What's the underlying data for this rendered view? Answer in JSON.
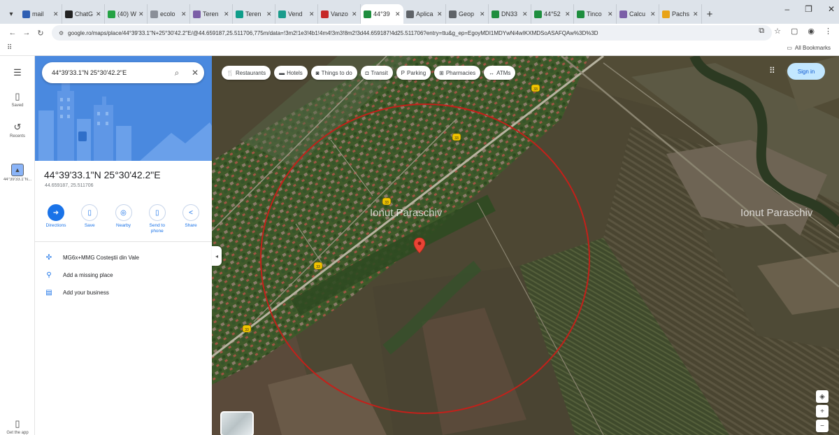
{
  "browser": {
    "tabs": [
      {
        "title": "mail",
        "favicon_color": "#2f5fb3"
      },
      {
        "title": "ChatG",
        "favicon_color": "#222222"
      },
      {
        "title": "(40) W",
        "favicon_color": "#25a244"
      },
      {
        "title": "ecolo",
        "favicon_color": "#8a8f98"
      },
      {
        "title": "Teren",
        "favicon_color": "#7b5ea7"
      },
      {
        "title": "Teren",
        "favicon_color": "#0f9d8a"
      },
      {
        "title": "Vend",
        "favicon_color": "#1a9c8c"
      },
      {
        "title": "Vanzo",
        "favicon_color": "#c62828"
      },
      {
        "title": "44°39",
        "favicon_color": "#1e8e3e",
        "active": true
      },
      {
        "title": "Aplica",
        "favicon_color": "#5f6368"
      },
      {
        "title": "Geop",
        "favicon_color": "#5f6368"
      },
      {
        "title": "DN33",
        "favicon_color": "#1e8e3e"
      },
      {
        "title": "44°52",
        "favicon_color": "#1e8e3e"
      },
      {
        "title": "Tinco",
        "favicon_color": "#1e8e3e"
      },
      {
        "title": "Calcu",
        "favicon_color": "#7b5ea7"
      },
      {
        "title": "Pachs",
        "favicon_color": "#e8a317"
      }
    ],
    "new_tab": "+",
    "url": "google.ro/maps/place/44°39'33.1\"N+25°30'42.2\"E/@44.659187,25.511706,775m/data=!3m2!1e3!4b1!4m4!3m3!8m2!3d44.659187!4d25.511706?entry=ttu&g_ep=EgoyMDI1MDYwNi4wIKXMDSoASAFQAw%3D%3D",
    "all_bookmarks": "All Bookmarks"
  },
  "rail": {
    "saved": "Saved",
    "recents": "Recents",
    "recent_place": "44°39'33.1\"N...",
    "get_app": "Get the app"
  },
  "panel": {
    "search_value": "44°39'33.1\"N 25°30'42.2\"E",
    "title": "44°39'33.1\"N 25°30'42.2\"E",
    "coords": "44.659187, 25.511706",
    "actions": [
      {
        "label": "Directions",
        "icon": "directions-icon"
      },
      {
        "label": "Save",
        "icon": "bookmark-icon"
      },
      {
        "label": "Nearby",
        "icon": "nearby-icon"
      },
      {
        "label": "Send to phone",
        "icon": "phone-icon"
      },
      {
        "label": "Share",
        "icon": "share-icon"
      }
    ],
    "info": [
      {
        "label": "MG6x+MMG Costeştii din Vale",
        "icon": "plus-code-icon"
      },
      {
        "label": "Add a missing place",
        "icon": "add-place-icon"
      },
      {
        "label": "Add your business",
        "icon": "business-icon"
      }
    ]
  },
  "map": {
    "chips": [
      {
        "label": "Restaurants",
        "icon": "restaurant-icon"
      },
      {
        "label": "Hotels",
        "icon": "hotel-icon"
      },
      {
        "label": "Things to do",
        "icon": "camera-icon"
      },
      {
        "label": "Transit",
        "icon": "transit-icon"
      },
      {
        "label": "Parking",
        "icon": "parking-icon"
      },
      {
        "label": "Pharmacies",
        "icon": "pharmacy-icon"
      },
      {
        "label": "ATMs",
        "icon": "atm-icon"
      }
    ],
    "sign_in": "Sign in",
    "watermark": "Ionut Paraschiv",
    "road_markers": [
      "33",
      "33",
      "33",
      "33",
      "33"
    ],
    "colors": {
      "circle": "#c4201a",
      "pin": "#ea4335",
      "accent": "#1a73e8"
    }
  }
}
